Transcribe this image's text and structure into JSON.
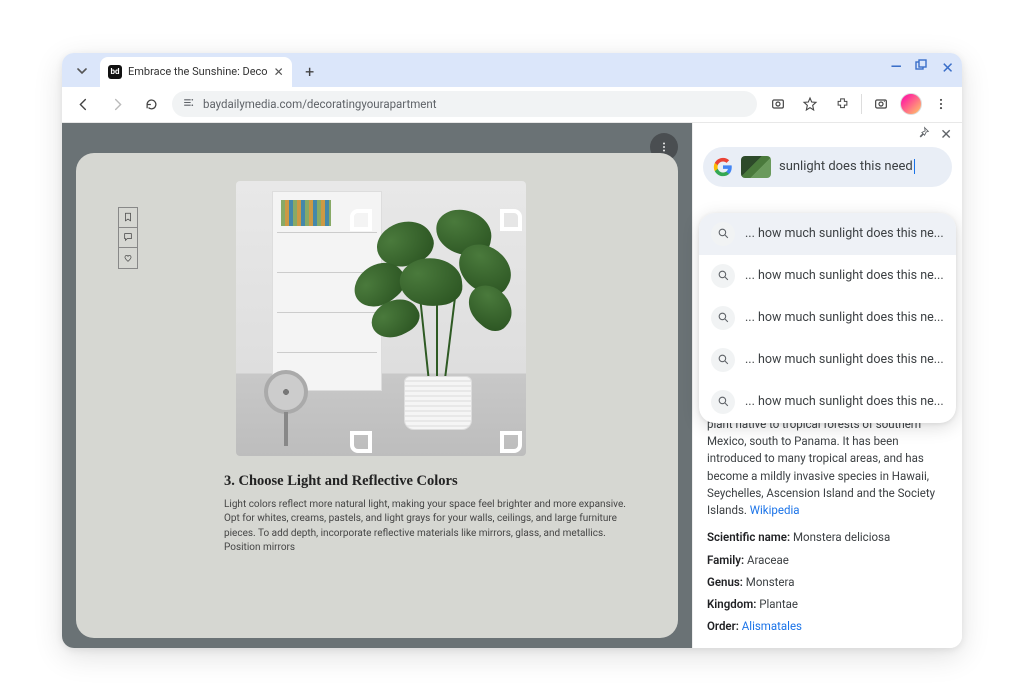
{
  "tab": {
    "favicon_text": "bd",
    "title": "Embrace the Sunshine: Deco"
  },
  "toolbar": {
    "url": "baydailymedia.com/decoratingyourapartment"
  },
  "article": {
    "heading": "3. Choose Light and Reflective Colors",
    "body": "Light colors reflect more natural light, making your space feel brighter and more expansive. Opt for whites, creams, pastels, and light grays for your walls, ceilings, and large furniture pieces. To add depth, incorporate reflective materials like mirrors, glass, and metallics. Position mirrors"
  },
  "sidepanel": {
    "search_text": "sunlight does this need",
    "suggestions": [
      "... how much sunlight does this ne...",
      "... how much sunlight does this ne...",
      "... how much sunlight does this ne...",
      "... how much sunlight does this ne...",
      "... how much sunlight does this ne..."
    ],
    "description": "leaf philodendron is a species of flowering plant native to tropical forests of southern Mexico, south to Panama. It has been introduced to many tropical areas, and has become a mildly invasive species in Hawaii, Seychelles, Ascension Island and the Society Islands.",
    "source_label": "Wikipedia",
    "taxonomy": {
      "scientific_name_k": "Scientific name:",
      "scientific_name_v": "Monstera deliciosa",
      "family_k": "Family:",
      "family_v": "Araceae",
      "genus_k": "Genus:",
      "genus_v": "Monstera",
      "kingdom_k": "Kingdom:",
      "kingdom_v": "Plantae",
      "order_k": "Order:",
      "order_v": "Alismatales"
    }
  }
}
